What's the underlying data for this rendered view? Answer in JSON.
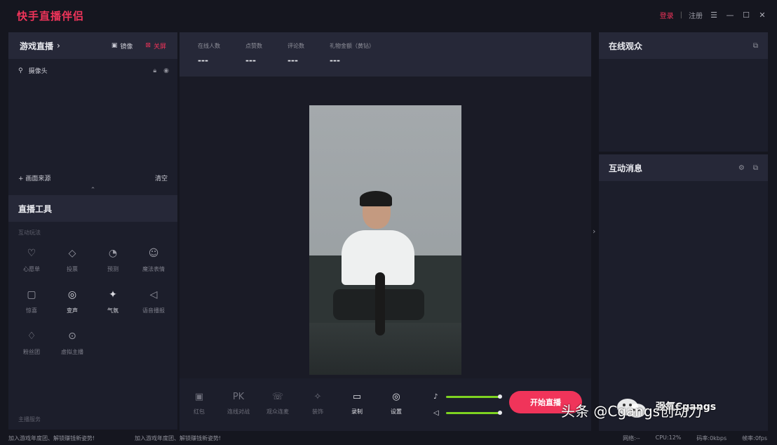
{
  "app": {
    "title": "快手直播伴侣"
  },
  "titlebar": {
    "login": "登录",
    "sep": "|",
    "register": "注册",
    "menu_icon": "☰",
    "minimize_icon": "—",
    "maximize_icon": "☐",
    "close_icon": "✕"
  },
  "game_live": {
    "title": "游戏直播",
    "open_label": "镜像",
    "close_label": "关屏",
    "camera_label": "摄像头",
    "add_source": "+ 画面来源",
    "clear": "清空"
  },
  "live_tools": {
    "title": "直播工具",
    "section_interactive": "互动玩法",
    "section_host": "主播服务",
    "items": [
      {
        "label": "心愿单",
        "icon": "♡"
      },
      {
        "label": "投票",
        "icon": "◇"
      },
      {
        "label": "预测",
        "icon": "◔"
      },
      {
        "label": "魔法表情",
        "icon": "☺"
      },
      {
        "label": "惊喜",
        "icon": "▢"
      },
      {
        "label": "变声",
        "icon": "◎"
      },
      {
        "label": "气氛",
        "icon": "✦"
      },
      {
        "label": "语音播报",
        "icon": "◁"
      },
      {
        "label": "粉丝团",
        "icon": "♢"
      },
      {
        "label": "虚拟主播",
        "icon": "⊙"
      }
    ]
  },
  "stats": [
    {
      "label": "在线人数",
      "value": "---"
    },
    {
      "label": "点赞数",
      "value": "---"
    },
    {
      "label": "评论数",
      "value": "---"
    },
    {
      "label": "礼物金额（黄钻）",
      "value": "---"
    }
  ],
  "controls": [
    {
      "label": "红包",
      "icon": "▣"
    },
    {
      "label": "连线对战",
      "icon": "PK"
    },
    {
      "label": "观众连麦",
      "icon": "☏"
    },
    {
      "label": "装饰",
      "icon": "✧"
    },
    {
      "label": "录制",
      "icon": "▭"
    },
    {
      "label": "设置",
      "icon": "◎"
    }
  ],
  "audio": {
    "mic_icon": "🎙",
    "speaker_icon": "◁",
    "mic_level": 1.0,
    "speaker_level": 1.0
  },
  "start_button": "开始直播",
  "right": {
    "online_title": "在线观众",
    "messages_title": "互动消息"
  },
  "status": {
    "msg1": "加入游戏年度团、解锁赚钱新姿势!",
    "msg2": "加入游戏年度团、解锁赚钱新姿势!",
    "network": "网络:--",
    "cpu": "CPU:12%",
    "bitrate": "码率:0kbps",
    "fps": "帧率:0fps"
  },
  "watermark": {
    "text": "头条 @Cgangs创动力",
    "brand": "强氧Cgangs"
  },
  "colors": {
    "accent": "#f0345a",
    "volume": "#7ed321",
    "panel": "#1c1e2b",
    "header": "#262838"
  }
}
